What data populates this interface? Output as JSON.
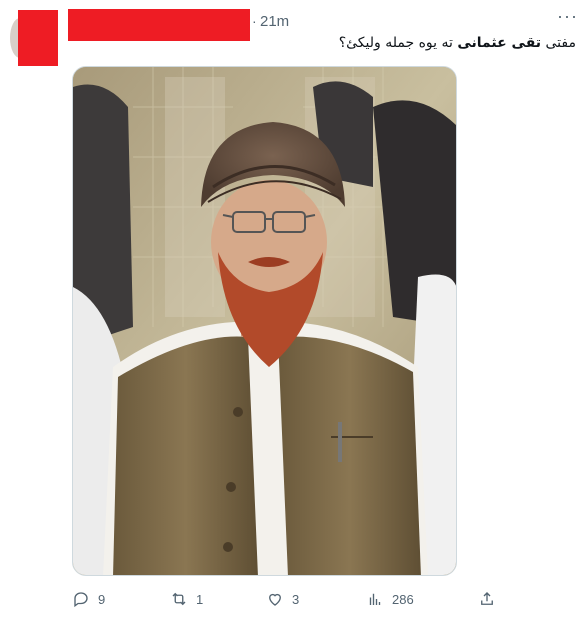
{
  "header": {
    "separator": "·",
    "time": "21m",
    "more_label": "···"
  },
  "tweet": {
    "text_before": "مفتی ",
    "text_bold": "تقی عثمانی",
    "text_after": " ته یوه جمله ولیکئ؟"
  },
  "media": {
    "alt": "photo"
  },
  "actions": {
    "reply": {
      "icon": "reply-icon",
      "count": "9"
    },
    "retweet": {
      "icon": "retweet-icon",
      "count": "1"
    },
    "like": {
      "icon": "heart-icon",
      "count": "3"
    },
    "views": {
      "icon": "views-icon",
      "count": "286"
    },
    "share": {
      "icon": "share-icon"
    }
  },
  "colors": {
    "redaction": "#ee1c24",
    "secondary_text": "#536471",
    "border": "#cfd9de"
  }
}
